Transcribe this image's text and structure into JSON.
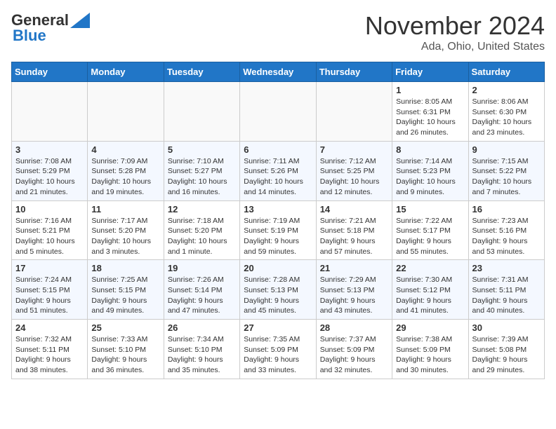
{
  "header": {
    "logo_line1": "General",
    "logo_line2": "Blue",
    "month": "November 2024",
    "location": "Ada, Ohio, United States"
  },
  "weekdays": [
    "Sunday",
    "Monday",
    "Tuesday",
    "Wednesday",
    "Thursday",
    "Friday",
    "Saturday"
  ],
  "weeks": [
    [
      {
        "day": "",
        "info": ""
      },
      {
        "day": "",
        "info": ""
      },
      {
        "day": "",
        "info": ""
      },
      {
        "day": "",
        "info": ""
      },
      {
        "day": "",
        "info": ""
      },
      {
        "day": "1",
        "info": "Sunrise: 8:05 AM\nSunset: 6:31 PM\nDaylight: 10 hours and 26 minutes."
      },
      {
        "day": "2",
        "info": "Sunrise: 8:06 AM\nSunset: 6:30 PM\nDaylight: 10 hours and 23 minutes."
      }
    ],
    [
      {
        "day": "3",
        "info": "Sunrise: 7:08 AM\nSunset: 5:29 PM\nDaylight: 10 hours and 21 minutes."
      },
      {
        "day": "4",
        "info": "Sunrise: 7:09 AM\nSunset: 5:28 PM\nDaylight: 10 hours and 19 minutes."
      },
      {
        "day": "5",
        "info": "Sunrise: 7:10 AM\nSunset: 5:27 PM\nDaylight: 10 hours and 16 minutes."
      },
      {
        "day": "6",
        "info": "Sunrise: 7:11 AM\nSunset: 5:26 PM\nDaylight: 10 hours and 14 minutes."
      },
      {
        "day": "7",
        "info": "Sunrise: 7:12 AM\nSunset: 5:25 PM\nDaylight: 10 hours and 12 minutes."
      },
      {
        "day": "8",
        "info": "Sunrise: 7:14 AM\nSunset: 5:23 PM\nDaylight: 10 hours and 9 minutes."
      },
      {
        "day": "9",
        "info": "Sunrise: 7:15 AM\nSunset: 5:22 PM\nDaylight: 10 hours and 7 minutes."
      }
    ],
    [
      {
        "day": "10",
        "info": "Sunrise: 7:16 AM\nSunset: 5:21 PM\nDaylight: 10 hours and 5 minutes."
      },
      {
        "day": "11",
        "info": "Sunrise: 7:17 AM\nSunset: 5:20 PM\nDaylight: 10 hours and 3 minutes."
      },
      {
        "day": "12",
        "info": "Sunrise: 7:18 AM\nSunset: 5:20 PM\nDaylight: 10 hours and 1 minute."
      },
      {
        "day": "13",
        "info": "Sunrise: 7:19 AM\nSunset: 5:19 PM\nDaylight: 9 hours and 59 minutes."
      },
      {
        "day": "14",
        "info": "Sunrise: 7:21 AM\nSunset: 5:18 PM\nDaylight: 9 hours and 57 minutes."
      },
      {
        "day": "15",
        "info": "Sunrise: 7:22 AM\nSunset: 5:17 PM\nDaylight: 9 hours and 55 minutes."
      },
      {
        "day": "16",
        "info": "Sunrise: 7:23 AM\nSunset: 5:16 PM\nDaylight: 9 hours and 53 minutes."
      }
    ],
    [
      {
        "day": "17",
        "info": "Sunrise: 7:24 AM\nSunset: 5:15 PM\nDaylight: 9 hours and 51 minutes."
      },
      {
        "day": "18",
        "info": "Sunrise: 7:25 AM\nSunset: 5:15 PM\nDaylight: 9 hours and 49 minutes."
      },
      {
        "day": "19",
        "info": "Sunrise: 7:26 AM\nSunset: 5:14 PM\nDaylight: 9 hours and 47 minutes."
      },
      {
        "day": "20",
        "info": "Sunrise: 7:28 AM\nSunset: 5:13 PM\nDaylight: 9 hours and 45 minutes."
      },
      {
        "day": "21",
        "info": "Sunrise: 7:29 AM\nSunset: 5:13 PM\nDaylight: 9 hours and 43 minutes."
      },
      {
        "day": "22",
        "info": "Sunrise: 7:30 AM\nSunset: 5:12 PM\nDaylight: 9 hours and 41 minutes."
      },
      {
        "day": "23",
        "info": "Sunrise: 7:31 AM\nSunset: 5:11 PM\nDaylight: 9 hours and 40 minutes."
      }
    ],
    [
      {
        "day": "24",
        "info": "Sunrise: 7:32 AM\nSunset: 5:11 PM\nDaylight: 9 hours and 38 minutes."
      },
      {
        "day": "25",
        "info": "Sunrise: 7:33 AM\nSunset: 5:10 PM\nDaylight: 9 hours and 36 minutes."
      },
      {
        "day": "26",
        "info": "Sunrise: 7:34 AM\nSunset: 5:10 PM\nDaylight: 9 hours and 35 minutes."
      },
      {
        "day": "27",
        "info": "Sunrise: 7:35 AM\nSunset: 5:09 PM\nDaylight: 9 hours and 33 minutes."
      },
      {
        "day": "28",
        "info": "Sunrise: 7:37 AM\nSunset: 5:09 PM\nDaylight: 9 hours and 32 minutes."
      },
      {
        "day": "29",
        "info": "Sunrise: 7:38 AM\nSunset: 5:09 PM\nDaylight: 9 hours and 30 minutes."
      },
      {
        "day": "30",
        "info": "Sunrise: 7:39 AM\nSunset: 5:08 PM\nDaylight: 9 hours and 29 minutes."
      }
    ]
  ]
}
